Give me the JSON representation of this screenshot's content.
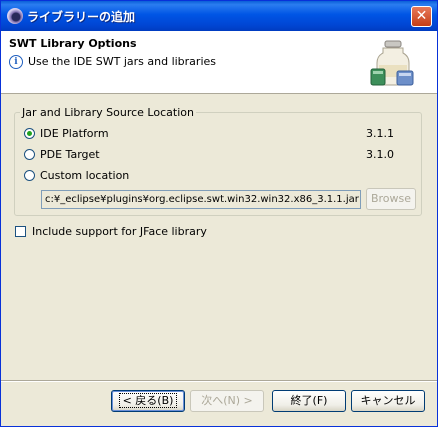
{
  "window": {
    "title": "ライブラリーの追加",
    "close_glyph": "✕"
  },
  "header": {
    "title": "SWT Library Options",
    "info_glyph": "i",
    "description": "Use the IDE SWT jars and libraries",
    "banner_icon": "jar-library-icon"
  },
  "group": {
    "legend": "Jar and Library Source Location",
    "options": [
      {
        "label": "IDE Platform",
        "version": "3.1.1",
        "selected": true
      },
      {
        "label": "PDE Target",
        "version": "3.1.0",
        "selected": false
      },
      {
        "label": "Custom location",
        "version": "",
        "selected": false
      }
    ],
    "path_value": "c:¥_eclipse¥plugins¥org.eclipse.swt.win32.win32.x86_3.1.1.jar",
    "browse_label": "Browse"
  },
  "jface": {
    "label": "Include support for JFace library",
    "checked": false
  },
  "buttons": {
    "back": "< 戻る(B)",
    "next": "次へ(N) >",
    "finish": "終了(F)",
    "cancel": "キャンセル"
  },
  "colors": {
    "titlebar": "#0055e5",
    "dialog_bg": "#ece9d8",
    "radio_dot": "#21a121"
  }
}
